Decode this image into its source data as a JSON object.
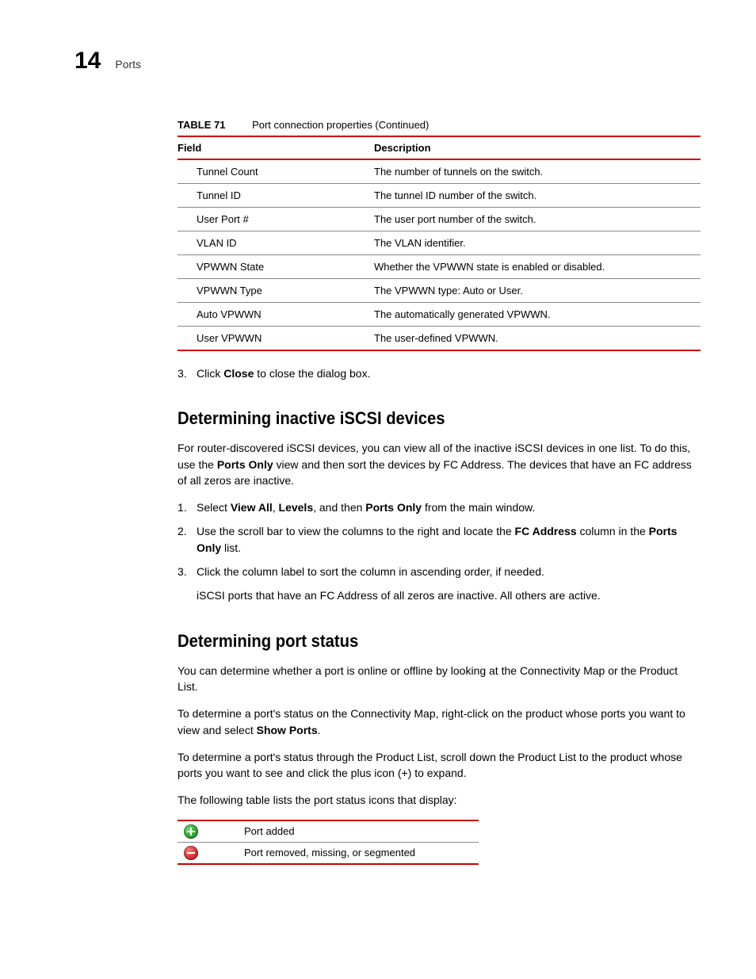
{
  "header": {
    "chapter_num": "14",
    "chapter_title": "Ports"
  },
  "table71": {
    "label": "TABLE 71",
    "title": "Port connection properties (Continued)",
    "col_field": "Field",
    "col_desc": "Description",
    "rows": [
      {
        "field": "Tunnel Count",
        "desc": "The number of tunnels on the switch."
      },
      {
        "field": "Tunnel ID",
        "desc": "The tunnel ID number of the switch."
      },
      {
        "field": "User Port #",
        "desc": "The user port number of the switch."
      },
      {
        "field": "VLAN ID",
        "desc": "The VLAN identifier."
      },
      {
        "field": "VPWWN State",
        "desc": "Whether the VPWWN state is enabled or disabled."
      },
      {
        "field": "VPWWN Type",
        "desc": "The VPWWN type: Auto or User."
      },
      {
        "field": "Auto VPWWN",
        "desc": "The automatically generated VPWWN."
      },
      {
        "field": "User VPWWN",
        "desc": "The user-defined VPWWN."
      }
    ]
  },
  "step3_top": {
    "num": "3.",
    "pre": "Click ",
    "b1": "Close",
    "post": " to close the dialog box."
  },
  "iscsi": {
    "heading": "Determining inactive iSCSI devices",
    "intro_pre": "For router-discovered iSCSI devices, you can view all of the inactive iSCSI devices in one list. To do this, use the ",
    "intro_b1": "Ports Only",
    "intro_post": " view and then sort the devices by FC Address. The devices that have an FC address of all zeros are inactive.",
    "s1": {
      "num": "1.",
      "pre": "Select ",
      "b1": "View All",
      "sep1": ", ",
      "b2": "Levels",
      "sep2": ", and then ",
      "b3": "Ports Only",
      "post": " from the main window."
    },
    "s2": {
      "num": "2.",
      "pre": "Use the scroll bar to view the columns to the right and locate the ",
      "b1": "FC Address",
      "mid": " column in the ",
      "b2": "Ports Only",
      "post": " list."
    },
    "s3": {
      "num": "3.",
      "text": "Click the column label to sort the column in ascending order, if needed."
    },
    "sub": "iSCSI ports that have an FC Address of all zeros are inactive. All others are active."
  },
  "portstatus": {
    "heading": "Determining port status",
    "p1": "You can determine whether a port is online or offline by looking at the Connectivity Map or the Product List.",
    "p2_pre": "To determine a port's status on the Connectivity Map, right-click on the product whose ports you want to view and select ",
    "p2_b": "Show Ports",
    "p2_post": ".",
    "p3": "To determine a port's status through the Product List, scroll down the Product List to the product whose ports you want to see and click the plus icon (+) to expand.",
    "p4": "The following table lists the port status icons that display:",
    "rows": [
      {
        "icon": "plus",
        "text": "Port added"
      },
      {
        "icon": "minus",
        "text": "Port removed, missing, or segmented"
      }
    ]
  }
}
